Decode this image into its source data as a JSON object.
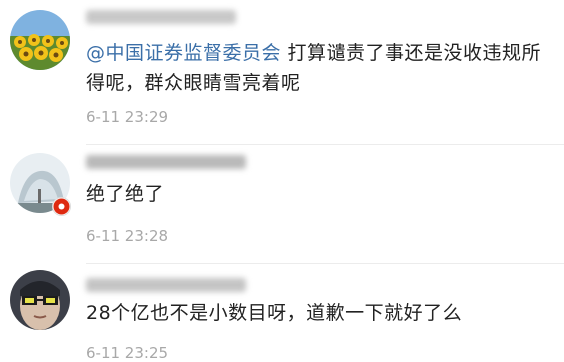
{
  "comments": [
    {
      "mention": "@中国证券监督委员会",
      "text": " 打算谴责了事还是没收违规所得呢，群众眼睛雪亮着呢",
      "time": "6-11 23:29"
    },
    {
      "text": "绝了绝了",
      "time": "6-11 23:28"
    },
    {
      "text": "28个亿也不是小数目呀，道歉一下就好了么",
      "time": "6-11 23:25"
    }
  ],
  "colors": {
    "mention": "#3b6fa8",
    "time": "#a8a8a8",
    "text": "#222222",
    "divider": "#ececec"
  },
  "icons": [
    "sunflower-avatar",
    "snow-tree-avatar",
    "glasses-person-avatar",
    "hk-flag-badge"
  ]
}
